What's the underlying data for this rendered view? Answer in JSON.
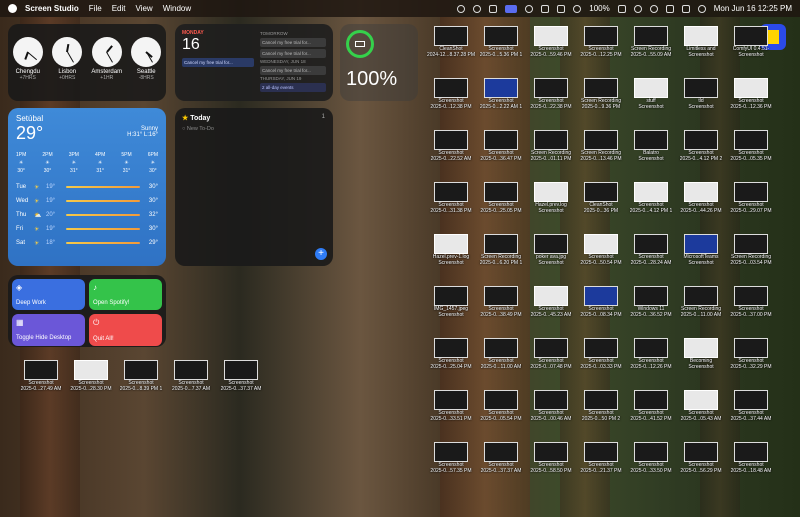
{
  "menubar": {
    "app_name": "Screen Studio",
    "menus": [
      "File",
      "Edit",
      "View",
      "Window"
    ],
    "battery": "100%",
    "datetime": "Mon Jun 16  12:25 PM"
  },
  "clocks": [
    {
      "city": "Chengdu",
      "offset": "+7HRS"
    },
    {
      "city": "Lisbon",
      "offset": "+0HRS"
    },
    {
      "city": "Amsterdam",
      "offset": "+1HR"
    },
    {
      "city": "Seattle",
      "offset": "-8HRS"
    }
  ],
  "calendar": {
    "weekday": "MONDAY",
    "day": "16",
    "today_event": "Cancel my free trial for...",
    "tomorrow_label": "TOMORROW",
    "tomorrow_events": [
      "Cancel my free trial for...",
      "Cancel my free trial for..."
    ],
    "wed_label": "WEDNESDAY, JUN 18",
    "wed_events": [
      "Cancel my free trial for..."
    ],
    "thu_label": "THURSDAY, JUN 19",
    "thu_events": [
      "2 all-day events"
    ]
  },
  "battery": {
    "percent": "100%",
    "level": 1.0
  },
  "weather": {
    "city": "Setúbal",
    "temp": "29°",
    "condition": "Sunny",
    "hilo": "H:31° L:16°",
    "hourly": [
      {
        "time": "1PM",
        "temp": "30°"
      },
      {
        "time": "2PM",
        "temp": "30°"
      },
      {
        "time": "3PM",
        "temp": "31°"
      },
      {
        "time": "4PM",
        "temp": "31°"
      },
      {
        "time": "5PM",
        "temp": "31°"
      },
      {
        "time": "6PM",
        "temp": "30°"
      }
    ],
    "daily": [
      {
        "day": "Tue",
        "lo": "19°",
        "hi": "30°"
      },
      {
        "day": "Wed",
        "lo": "19°",
        "hi": "30°"
      },
      {
        "day": "Thu",
        "lo": "20°",
        "hi": "32°"
      },
      {
        "day": "Fri",
        "lo": "19°",
        "hi": "30°"
      },
      {
        "day": "Sat",
        "lo": "18°",
        "hi": "29°"
      }
    ]
  },
  "reminders": {
    "title": "Today",
    "item": "New To-Do",
    "count": "1"
  },
  "shortcuts": [
    {
      "label": "Deep Work",
      "color": "#3a6fe0"
    },
    {
      "label": "Open Spotify!",
      "color": "#34c34a"
    },
    {
      "label": "Toggle Hide Desktop",
      "color": "#6b57d8"
    },
    {
      "label": "Quit All!",
      "color": "#ef4b4b"
    }
  ],
  "desktop_files": [
    {
      "label": "CleanShot",
      "sub": "2024-12...8.37.28 PM",
      "kind": "dark"
    },
    {
      "label": "Screenshot",
      "sub": "2025-0...5.36 PM 1",
      "kind": "dark"
    },
    {
      "label": "Screenshot",
      "sub": "2025-0...59.46 PM",
      "kind": "light"
    },
    {
      "label": "Screenshot",
      "sub": "2025-0...12.25 PM",
      "kind": "dark"
    },
    {
      "label": "Screen Recording",
      "sub": "2025-0...55.09 AM",
      "kind": "dark"
    },
    {
      "label": "Limitless and",
      "sub": "Screenshot",
      "kind": "light"
    },
    {
      "label": "ComfyUI 0.4.51-",
      "sub": "Screenshot",
      "kind": "dark"
    },
    {
      "label": "Screenshot",
      "sub": "2025-0...12.38 PM",
      "kind": "dark"
    },
    {
      "label": "Screenshot",
      "sub": "2025-0...2.22 AM 1",
      "kind": "blue"
    },
    {
      "label": "Screenshot",
      "sub": "2025-0...22.38 PM",
      "kind": "dark"
    },
    {
      "label": "Screen Recording",
      "sub": "2025-0...9.36 PM",
      "kind": "dark"
    },
    {
      "label": "stuff",
      "sub": "Screenshot",
      "kind": "light"
    },
    {
      "label": "tld",
      "sub": "Screenshot",
      "kind": "dark"
    },
    {
      "label": "Screenshot",
      "sub": "2025-0...12.36 PM",
      "kind": "light"
    },
    {
      "label": "Screenshot",
      "sub": "2025-0...22.52 AM",
      "kind": "dark"
    },
    {
      "label": "Screenshot",
      "sub": "2025-0...36.47 PM",
      "kind": "dark"
    },
    {
      "label": "Screen Recording",
      "sub": "2025-0...01.11 PM",
      "kind": "dark"
    },
    {
      "label": "Screen Recording",
      "sub": "2025-0...13.46 PM",
      "kind": "dark"
    },
    {
      "label": "Balatro",
      "sub": "Screenshot",
      "kind": "dark"
    },
    {
      "label": "Screenshot",
      "sub": "2025-0...4.12 PM 2",
      "kind": "dark"
    },
    {
      "label": "Screenshot",
      "sub": "2025-0...05.35 PM",
      "kind": "dark"
    },
    {
      "label": "Screenshot",
      "sub": "2025-0...31.38 PM",
      "kind": "dark"
    },
    {
      "label": "Screenshot",
      "sub": "2025-0...25.05 PM",
      "kind": "dark"
    },
    {
      "label": "Hazel.prev.log",
      "sub": "Screenshot",
      "kind": "light"
    },
    {
      "label": "CleanShot",
      "sub": "2025-0...36 PM",
      "kind": "dark"
    },
    {
      "label": "Screenshot",
      "sub": "2025-0...4.12 PM 1",
      "kind": "light"
    },
    {
      "label": "Screenshot",
      "sub": "2025-0...44.26 PM",
      "kind": "light"
    },
    {
      "label": "Screenshot",
      "sub": "2025-0...29.07 PM",
      "kind": "dark"
    },
    {
      "label": "Hazel.prev-1.log",
      "sub": "Screenshot",
      "kind": "light"
    },
    {
      "label": "Screen Recording",
      "sub": "2025-0...6.20 PM 1",
      "kind": "dark"
    },
    {
      "label": "poker ava.jpg",
      "sub": "Screenshot",
      "kind": "dark"
    },
    {
      "label": "Screenshot",
      "sub": "2025-0...50.54 PM",
      "kind": "light"
    },
    {
      "label": "Screenshot",
      "sub": "2025-0...28.24 AM",
      "kind": "dark"
    },
    {
      "label": "MicrosoftTeams",
      "sub": "Screenshot",
      "kind": "blue"
    },
    {
      "label": "Screen Recording",
      "sub": "2025-0...03.54 PM",
      "kind": "dark"
    },
    {
      "label": "IMG_1457.jpeg",
      "sub": "Screenshot",
      "kind": "dark"
    },
    {
      "label": "Screenshot",
      "sub": "2025-0...38.49 PM",
      "kind": "dark"
    },
    {
      "label": "Screenshot",
      "sub": "2025-0...45.23 AM",
      "kind": "light"
    },
    {
      "label": "Screenshot",
      "sub": "2025-0...08.34 PM",
      "kind": "blue"
    },
    {
      "label": "Windows 11",
      "sub": "2025-0...36.52 PM",
      "kind": "dark"
    },
    {
      "label": "Screen Recording",
      "sub": "2025-0...11.00 AM",
      "kind": "dark"
    },
    {
      "label": "Screenshot",
      "sub": "2025-0...37.00 PM",
      "kind": "dark"
    },
    {
      "label": "Screenshot",
      "sub": "2025-0...25.04 PM",
      "kind": "dark"
    },
    {
      "label": "Screenshot",
      "sub": "2025-0...11.00 AM",
      "kind": "dark"
    },
    {
      "label": "Screenshot",
      "sub": "2025-0...07.48 PM",
      "kind": "dark"
    },
    {
      "label": "Screenshot",
      "sub": "2025-0...03.33 PM",
      "kind": "dark"
    },
    {
      "label": "Screenshot",
      "sub": "2025-0...12.26 PM",
      "kind": "dark"
    },
    {
      "label": "Becoming",
      "sub": "Screenshot",
      "kind": "light"
    },
    {
      "label": "Screenshot",
      "sub": "2025-0...32.29 PM",
      "kind": "dark"
    },
    {
      "label": "Screenshot",
      "sub": "2025-0...33.51 PM",
      "kind": "dark"
    },
    {
      "label": "Screenshot",
      "sub": "2025-0...05.54 PM",
      "kind": "dark"
    },
    {
      "label": "Screenshot",
      "sub": "2025-0...00.46 AM",
      "kind": "dark"
    },
    {
      "label": "Screenshot",
      "sub": "2025-0...50 PM 2",
      "kind": "dark"
    },
    {
      "label": "Screenshot",
      "sub": "2025-0...41.52 PM",
      "kind": "dark"
    },
    {
      "label": "Screenshot",
      "sub": "2025-0...05.43 AM",
      "kind": "light"
    },
    {
      "label": "Screenshot",
      "sub": "2025-0...37.44 AM",
      "kind": "dark"
    },
    {
      "label": "Screenshot",
      "sub": "2025-0...57.35 PM",
      "kind": "dark"
    },
    {
      "label": "Screenshot",
      "sub": "2025-0...37.37 AM",
      "kind": "dark"
    },
    {
      "label": "Screenshot",
      "sub": "2025-0...58.50 PM",
      "kind": "dark"
    },
    {
      "label": "Screenshot",
      "sub": "2025-0...21.37 PM",
      "kind": "dark"
    },
    {
      "label": "Screenshot",
      "sub": "2025-0...33.50 PM",
      "kind": "dark"
    },
    {
      "label": "Screenshot",
      "sub": "2025-0...56.29 PM",
      "kind": "dark"
    },
    {
      "label": "Screenshot",
      "sub": "2025-0...18.48 AM",
      "kind": "dark"
    },
    {
      "label": "Screenshot",
      "sub": "2025-0...27.49 AM",
      "kind": "dark"
    },
    {
      "label": "Screenshot",
      "sub": "2025-0...28.30 PM",
      "kind": "light"
    },
    {
      "label": "Screenshot",
      "sub": "2025-0...8.39 PM 1",
      "kind": "dark"
    },
    {
      "label": "Screenshot",
      "sub": "2025-0...7.37 AM",
      "kind": "dark"
    },
    {
      "label": "Screenshot",
      "sub": "2025-0...37.37 AM",
      "kind": "dark"
    }
  ]
}
